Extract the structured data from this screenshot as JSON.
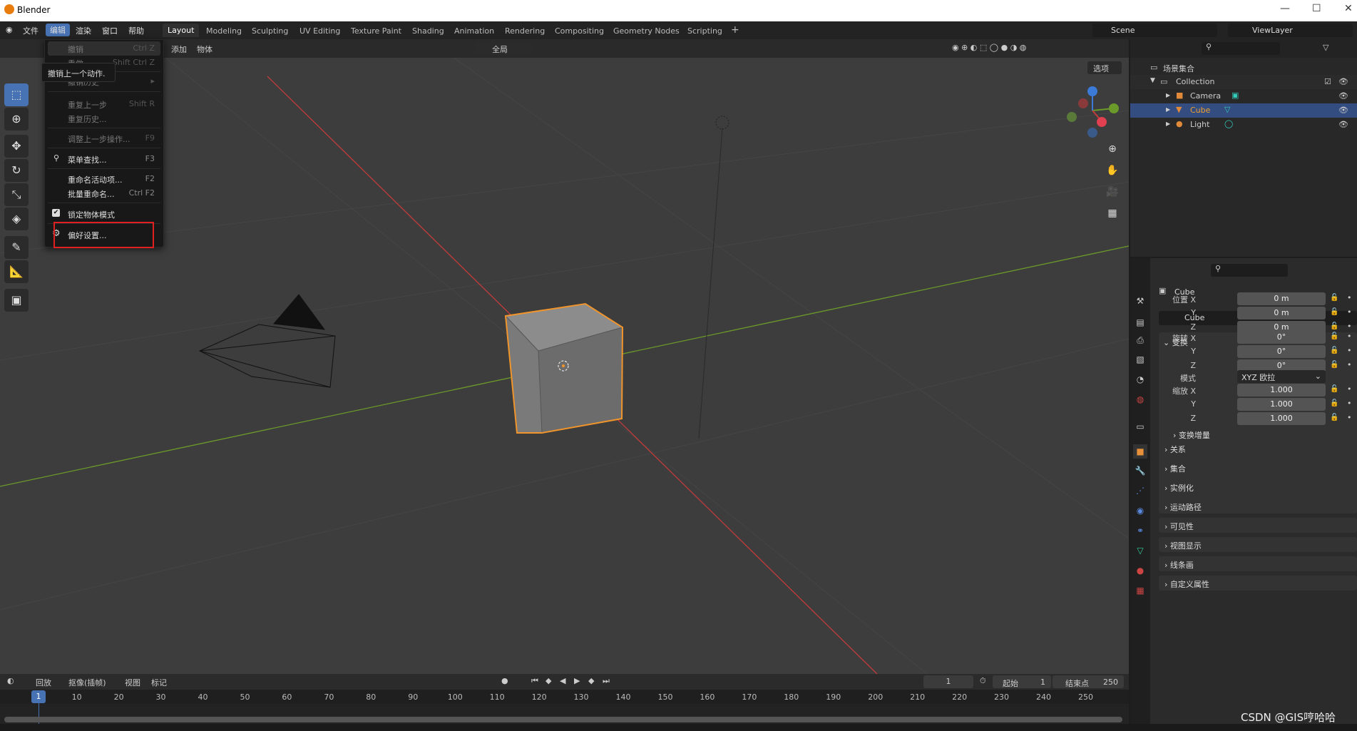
{
  "window": {
    "title": "Blender",
    "controls": [
      "—",
      "☐",
      "✕"
    ]
  },
  "menubar": {
    "items": [
      "文件",
      "编辑",
      "渲染",
      "窗口",
      "帮助"
    ],
    "active": "编辑"
  },
  "workspaces": {
    "tabs": [
      "Layout",
      "Modeling",
      "Sculpting",
      "UV Editing",
      "Texture Paint",
      "Shading",
      "Animation",
      "Rendering",
      "Compositing",
      "Geometry Nodes",
      "Scripting",
      "+"
    ],
    "active": "Layout"
  },
  "scene": {
    "name": "Scene",
    "view_layer": "ViewLayer"
  },
  "viewport": {
    "header_menus": [
      "添加",
      "物体"
    ],
    "transform_orientation": "全局",
    "options_label": "选项"
  },
  "edit_menu": {
    "items": [
      {
        "label": "撤销",
        "shortcut": "Ctrl Z",
        "disabled": true
      },
      {
        "label": "重做",
        "shortcut": "Shift Ctrl Z",
        "disabled": true
      },
      {
        "label": "撤销历史",
        "shortcut": "▸",
        "disabled": true
      },
      {
        "label": "重复上一步",
        "shortcut": "Shift R",
        "disabled": true
      },
      {
        "label": "重复历史...",
        "shortcut": "",
        "disabled": true
      },
      {
        "label": "调整上一步操作...",
        "shortcut": "F9",
        "disabled": true
      },
      {
        "label": "菜单查找...",
        "shortcut": "F3",
        "disabled": false,
        "icon": "search"
      },
      {
        "label": "重命名活动项...",
        "shortcut": "F2",
        "disabled": false
      },
      {
        "label": "批量重命名...",
        "shortcut": "Ctrl F2",
        "disabled": false
      },
      {
        "label": "锁定物体模式",
        "shortcut": "",
        "disabled": false,
        "icon": "checkbox-checked"
      },
      {
        "label": "偏好设置...",
        "shortcut": "",
        "disabled": false,
        "icon": "gear",
        "highlighted": true
      }
    ],
    "tooltip": "撤销上一个动作."
  },
  "outliner": {
    "root": "场景集合",
    "collection": "Collection",
    "objects": [
      {
        "name": "Camera",
        "selected": false
      },
      {
        "name": "Cube",
        "selected": true
      },
      {
        "name": "Light",
        "selected": false
      }
    ]
  },
  "properties": {
    "object_name": "Cube",
    "datablock": "Cube",
    "section": "变换",
    "location": {
      "label": "位置",
      "x": "0 m",
      "y": "0 m",
      "z": "0 m"
    },
    "rotation": {
      "label": "旋转",
      "x": "0°",
      "y": "0°",
      "z": "0°"
    },
    "mode": {
      "label": "模式",
      "value": "XYZ 欧拉"
    },
    "scale": {
      "label": "缩放",
      "x": "1.000",
      "y": "1.000",
      "z": "1.000"
    },
    "subpanel": "变换增量",
    "panels": [
      "关系",
      "集合",
      "实例化",
      "运动路径",
      "可见性",
      "视图显示",
      "线条画",
      "自定义属性"
    ]
  },
  "timeline": {
    "menus": [
      "回放",
      "抠像(插帧)",
      "视图",
      "标记"
    ],
    "current_frame": "1",
    "start_label": "起始",
    "start": "1",
    "end_label": "结束点",
    "end": "250",
    "ticks": [
      "10",
      "20",
      "30",
      "40",
      "50",
      "60",
      "70",
      "80",
      "90",
      "100",
      "110",
      "120",
      "130",
      "140",
      "150",
      "160",
      "170",
      "180",
      "190",
      "200",
      "210",
      "220",
      "230",
      "240",
      "250"
    ]
  },
  "watermark": "CSDN @GIS哼哈哈",
  "colors": {
    "accent": "#4772b3",
    "selected_outline": "#f0942b",
    "x_axis": "#c33b3b",
    "y_axis": "#6b9a2a",
    "highlight_box": "#e02020"
  }
}
